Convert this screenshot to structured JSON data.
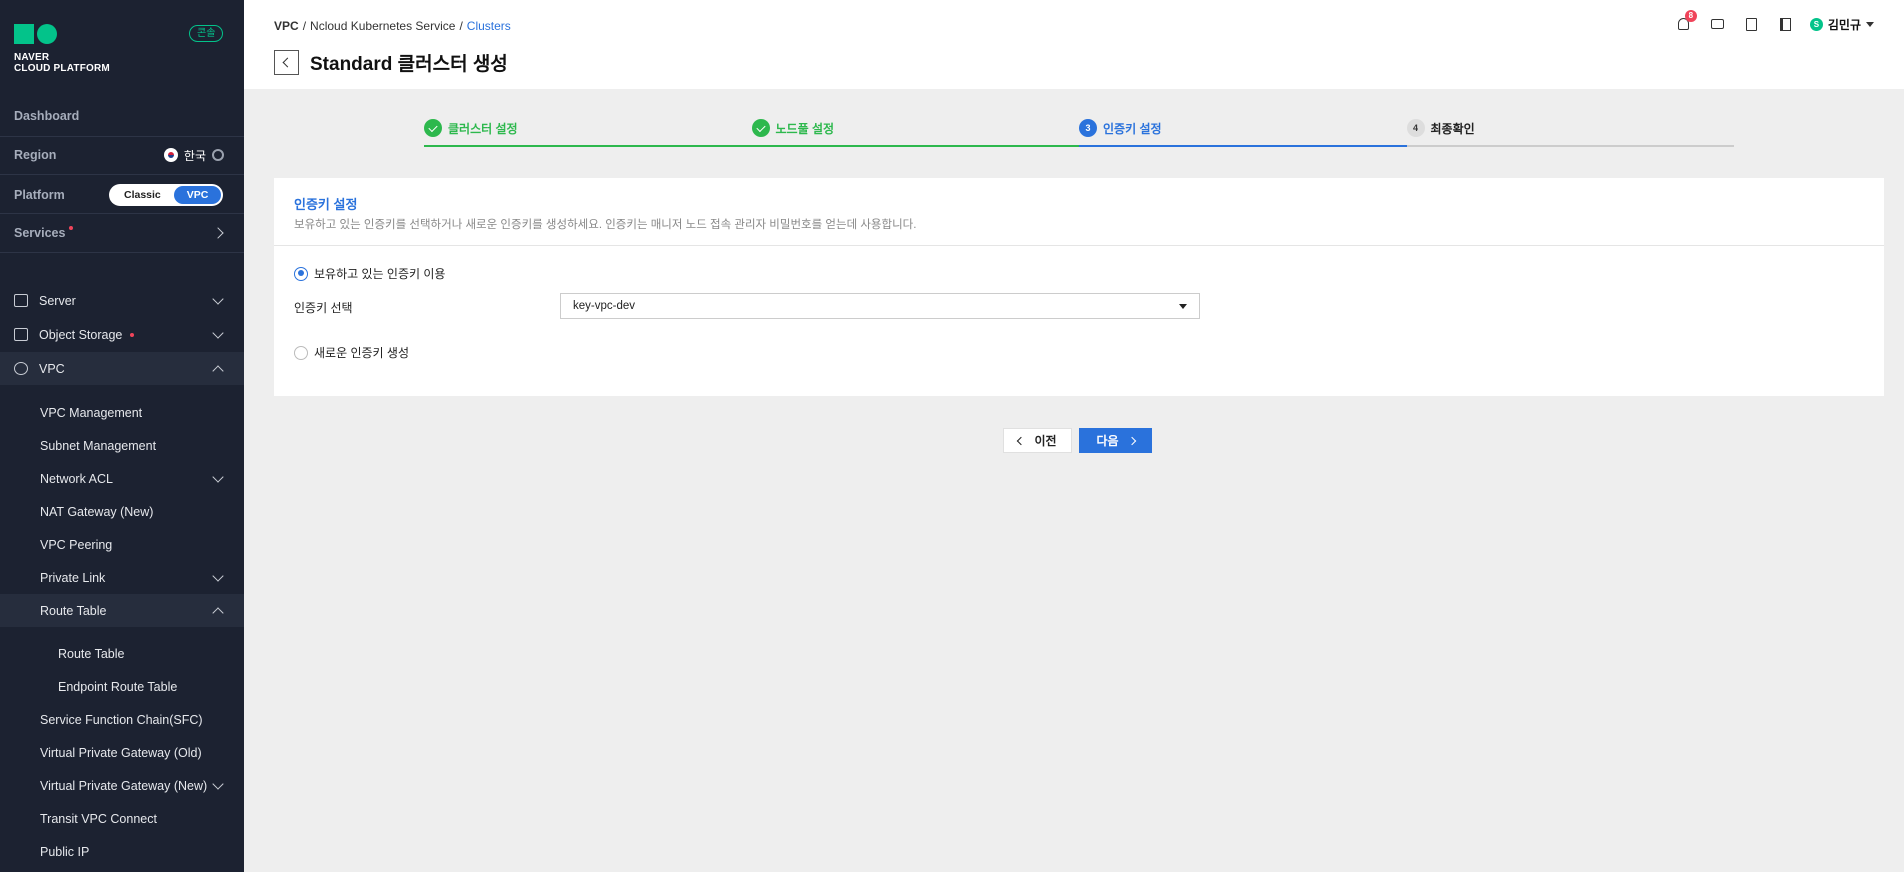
{
  "sidebar": {
    "logo_line1": "NAVER",
    "logo_line2": "CLOUD PLATFORM",
    "console_badge": "콘솔",
    "dashboard": "Dashboard",
    "region_label": "Region",
    "region_value": "한국",
    "platform_label": "Platform",
    "platform_options": [
      "Classic",
      "VPC"
    ],
    "platform_selected": "VPC",
    "services_label": "Services",
    "menu": [
      {
        "label": "Server",
        "icon": "server-icon"
      },
      {
        "label": "Object Storage",
        "icon": "storage-icon"
      },
      {
        "label": "VPC",
        "icon": "vpc-icon"
      }
    ],
    "vpc_items": [
      "VPC Management",
      "Subnet Management",
      "Network ACL",
      "NAT Gateway (New)",
      "VPC Peering",
      "Private Link",
      "Route Table"
    ],
    "route_table_items": [
      "Route Table",
      "Endpoint Route Table"
    ],
    "more_items": [
      "Service Function Chain(SFC)",
      "Virtual Private Gateway (Old)",
      "Virtual Private Gateway (New)",
      "Transit VPC Connect",
      "Public IP"
    ]
  },
  "header": {
    "breadcrumb": [
      "VPC",
      "/",
      "Ncloud Kubernetes Service",
      "/",
      "Clusters"
    ],
    "title": "Standard 클러스터 생성",
    "notification_count": "8",
    "user_badge": "S",
    "user_name": "김민규"
  },
  "steps": [
    {
      "label": "클러스터 설정",
      "state": "done",
      "num": ""
    },
    {
      "label": "노드풀 설정",
      "state": "done",
      "num": ""
    },
    {
      "label": "인증키 설정",
      "state": "current",
      "num": "3"
    },
    {
      "label": "최종확인",
      "state": "todo",
      "num": "4"
    }
  ],
  "panel": {
    "title": "인증키 설정",
    "description": "보유하고 있는 인증키를 선택하거나 새로운 인증키를 생성하세요. 인증키는 매니저 노드 접속 관리자 비밀번호를 얻는데 사용합니다.",
    "option_existing": "보유하고 있는 인증키 이용",
    "field_label": "인증키 선택",
    "selected_key": "key-vpc-dev",
    "option_new": "새로운 인증키 생성"
  },
  "buttons": {
    "prev": "이전",
    "next": "다음"
  },
  "colors": {
    "accent": "#2a72dc",
    "success": "#2db84d",
    "brand": "#03c38a",
    "sidebar_bg": "#1c2231"
  }
}
